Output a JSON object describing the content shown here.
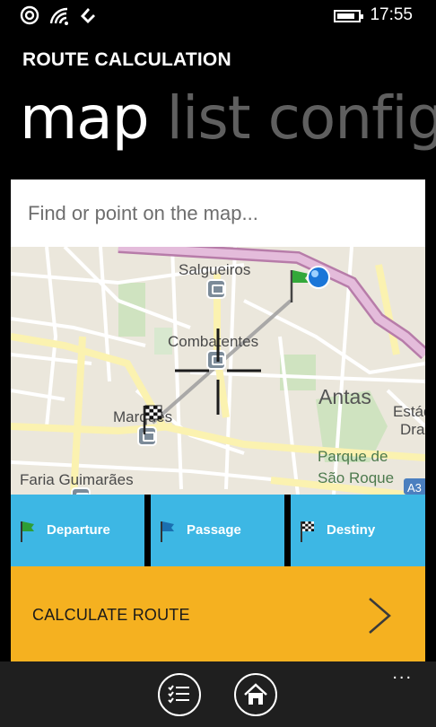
{
  "status_bar": {
    "time": "17:55",
    "icons": [
      "data-sync-icon",
      "wifi-icon",
      "network-icon",
      "battery-icon"
    ]
  },
  "app": {
    "title": "ROUTE CALCULATION",
    "pivots": [
      {
        "label": "map",
        "active": true
      },
      {
        "label": "list",
        "active": false
      },
      {
        "label": "config",
        "active": false
      }
    ]
  },
  "search": {
    "placeholder": "Find or point on the map..."
  },
  "map": {
    "labels": {
      "salgueiros": "Salgueiros",
      "combatentes": "Combatentes",
      "antas": "Antas",
      "marques": "Marquês",
      "estadio": "Estád",
      "estadio2": "Dra",
      "parque": "Parque de",
      "sao_roque": "São Roque",
      "faria": "Faria Guimarães",
      "road_sign": "A3"
    },
    "markers": [
      "departure-flag-icon",
      "location-dot-icon",
      "destiny-flag-icon",
      "crosshair-icon"
    ]
  },
  "modes": {
    "departure": "Departure",
    "passage": "Passage",
    "destiny": "Destiny"
  },
  "calculate": {
    "label": "CALCULATE ROUTE"
  },
  "appbar": {
    "more": "..."
  },
  "colors": {
    "accent_blue": "#3db7e4",
    "accent_orange": "#f5b120",
    "inactive_pivot": "#5f5f5f",
    "highway": "#c79bc0"
  }
}
